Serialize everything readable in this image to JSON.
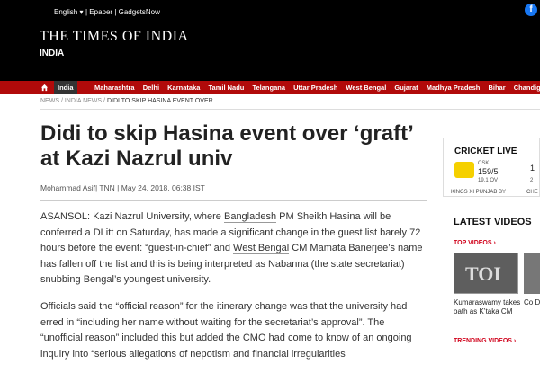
{
  "topbar": {
    "language": "English ▾",
    "links": "| Epaper | GadgetsNow",
    "social": "f"
  },
  "masthead": {
    "logo": "THE TIMES OF INDIA",
    "edition": "INDIA"
  },
  "nav": {
    "active": "India",
    "items": [
      "Maharashtra",
      "Delhi",
      "Karnataka",
      "Tamil Nadu",
      "Telangana",
      "Uttar Pradesh",
      "West Bengal",
      "Gujarat",
      "Madhya Pradesh",
      "Bihar",
      "Chandigarh"
    ]
  },
  "breadcrumb": {
    "items": [
      "NEWS",
      "INDIA NEWS"
    ],
    "sep": "/",
    "current": "DIDI TO SKIP HASINA EVENT OVER"
  },
  "article": {
    "headline": "Didi to skip Hasina event over ‘graft’ at Kazi Nazrul univ",
    "byline": "Mohammad Asif| TNN | May 24, 2018, 06:38 IST",
    "p1_a": "ASANSOL: Kazi Nazrul University, where ",
    "p1_link1": "Bangladesh",
    "p1_b": " PM Sheikh Hasina will be conferred a DLitt on Saturday, has made a significant change in the guest list barely 72 hours before the event: “guest-in-chief” and ",
    "p1_link2": "West Bengal",
    "p1_c": " CM Mamata Banerjee’s name has fallen off the list and this is being interpreted as Nabanna (the state secretariat) snubbing Bengal’s youngest university.",
    "p2": "Officials said the “official reason” for the itinerary change was that the university had erred in “including her name without waiting for the secretariat’s approval”. The “unofficial reason” included this but added the CMO had come to know of an ongoing inquiry into “serious allegations of nepotism and financial irregularities"
  },
  "sidebar": {
    "cricket_title": "CRICKET LIVE",
    "team": "CSK",
    "score": "159/5",
    "overs": "19.1 OV",
    "match": "KINGS XI PUNJAB BY",
    "next_score": "1",
    "next_overs": "2",
    "next_label": "CHE",
    "latest_title": "LATEST VIDEOS",
    "top_videos": "TOP VIDEOS ›",
    "thumb_logo": "TOI",
    "caption1": "Kumaraswamy takes oath as K’taka CM",
    "caption2": "Co D",
    "trending": "TRENDING VIDEOS ›"
  },
  "colors": {
    "nav_red": "#b10a0a",
    "accent_red": "#d0021b",
    "masthead": "#000000"
  }
}
